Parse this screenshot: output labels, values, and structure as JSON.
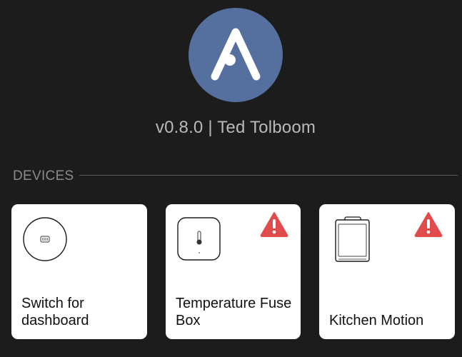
{
  "header": {
    "logo_icon": "app-logo-a-icon",
    "version_line": "v0.8.0 | Ted Tolboom"
  },
  "devices_section": {
    "label": "DEVICES",
    "devices": [
      {
        "name": "Switch for dashboard",
        "icon": "xiaomi-round-switch-icon",
        "warning": false
      },
      {
        "name": "Temperature Fuse Box",
        "icon": "temperature-sensor-icon",
        "warning": true
      },
      {
        "name": "Kitchen Motion",
        "icon": "motion-sensor-panel-icon",
        "warning": true
      }
    ]
  },
  "colors": {
    "background": "#1c1c1c",
    "logo_circle": "#55709e",
    "warning_red": "#e14b4b",
    "card": "#ffffff"
  }
}
